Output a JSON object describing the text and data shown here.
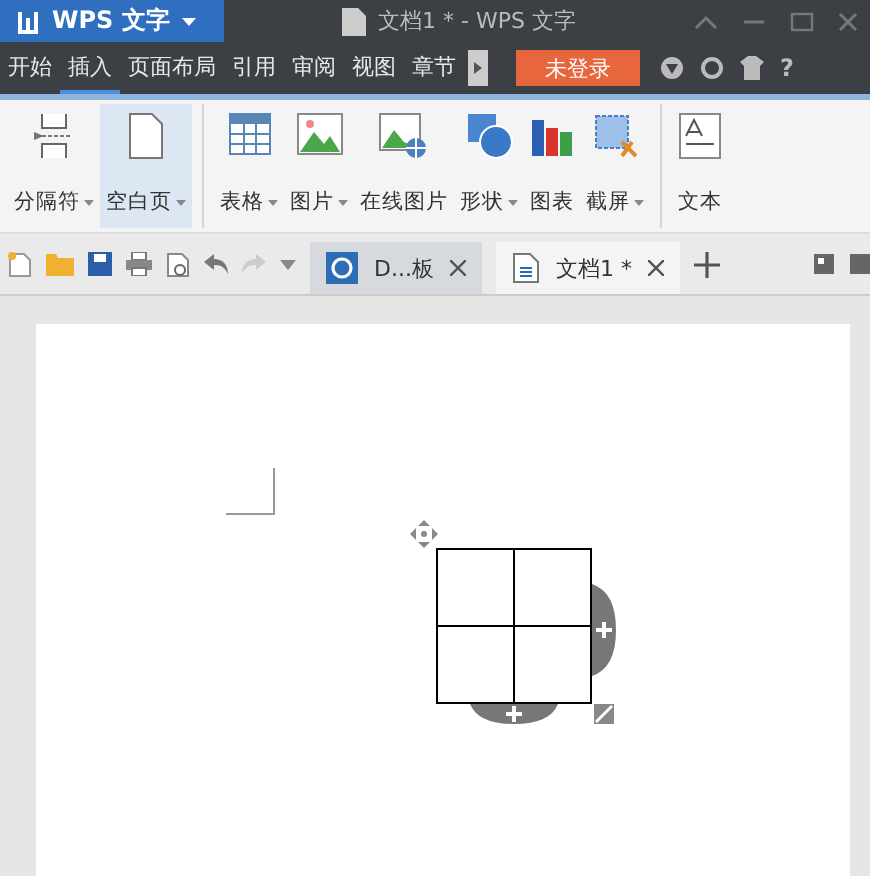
{
  "app_button": {
    "label": "WPS 文字"
  },
  "window": {
    "title": "文档1 * - WPS 文字"
  },
  "menu_tabs": [
    {
      "label": "开始",
      "selected": false
    },
    {
      "label": "插入",
      "selected": true
    },
    {
      "label": "页面布局",
      "selected": false
    },
    {
      "label": "引用",
      "selected": false
    },
    {
      "label": "审阅",
      "selected": false
    },
    {
      "label": "视图",
      "selected": false
    },
    {
      "label": "章节",
      "selected": false
    }
  ],
  "login_button": {
    "label": "未登录"
  },
  "help_button": {
    "label": "?"
  },
  "ribbon": [
    {
      "kind": "break",
      "label": "分隔符",
      "dropdown": true,
      "selected": false,
      "group_end": false
    },
    {
      "kind": "page",
      "label": "空白页",
      "dropdown": true,
      "selected": true,
      "group_end": true
    },
    {
      "kind": "table",
      "label": "表格",
      "dropdown": true,
      "selected": false,
      "group_end": false
    },
    {
      "kind": "picture",
      "label": "图片",
      "dropdown": true,
      "selected": false,
      "group_end": false
    },
    {
      "kind": "online",
      "label": "在线图片",
      "dropdown": false,
      "selected": false,
      "group_end": false
    },
    {
      "kind": "shape",
      "label": "形状",
      "dropdown": true,
      "selected": false,
      "group_end": false
    },
    {
      "kind": "chart",
      "label": "图表",
      "dropdown": false,
      "selected": false,
      "group_end": false
    },
    {
      "kind": "screenshot",
      "label": "截屏",
      "dropdown": true,
      "selected": false,
      "group_end": true
    },
    {
      "kind": "textbox",
      "label": "文本",
      "dropdown": false,
      "selected": false,
      "group_end": false
    }
  ],
  "doc_tabs": [
    {
      "label": "D...板",
      "kind": "template",
      "selected": false
    },
    {
      "label": "文档1 *",
      "kind": "document",
      "selected": true
    }
  ]
}
